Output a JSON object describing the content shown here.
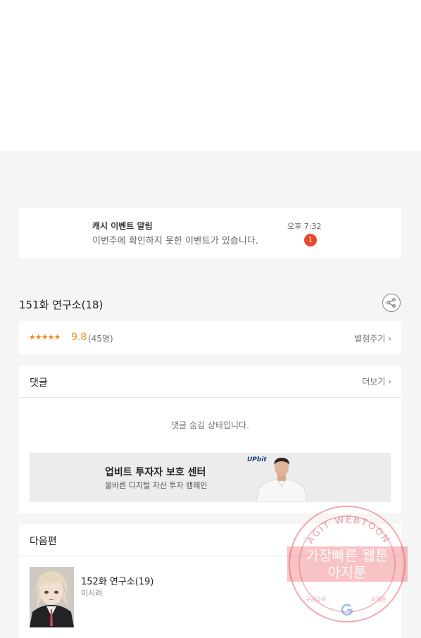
{
  "notification": {
    "title": "캐시 이벤트 알림",
    "message": "이번주에 확인하지 못한 이벤트가 있습니다.",
    "time": "오후 7:32",
    "badge_count": "1"
  },
  "episode": {
    "title": "151화 연구소(18)",
    "share_icon": "share-icon"
  },
  "rating": {
    "stars": "★★★★★",
    "score": "9.8",
    "count": "(45명)",
    "rate_label": "별점주기 ›"
  },
  "comments": {
    "label": "댓글",
    "more_label": "더보기 ›",
    "hidden_message": "댓글 숨김 상태입니다."
  },
  "ad": {
    "title": "업비트 투자자 보호 센터",
    "subtitle": "올바른 디지털 자산 투자 캠페인",
    "logo": "UPbit"
  },
  "next": {
    "label": "다음편",
    "episode_title": "152화 연구소(19)",
    "author": "이시려"
  },
  "watermark": {
    "top_text": "AGIT WEBTOON",
    "line1": "가장빠른 웹툰",
    "line2": "아지툰",
    "bottom_left": "구글검색",
    "bottom_right": "아지툰",
    "color": "#e8535a"
  }
}
